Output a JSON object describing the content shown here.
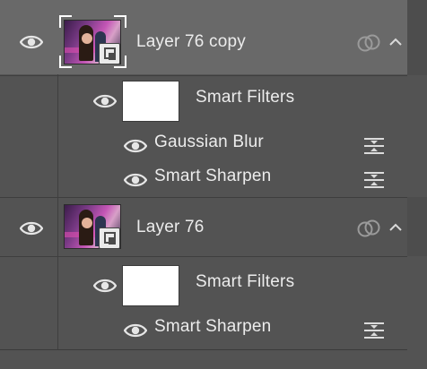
{
  "layers": [
    {
      "name": "Layer 76 copy",
      "selected": true,
      "smart_filters_label": "Smart Filters",
      "filters": [
        "Gaussian Blur",
        "Smart Sharpen"
      ]
    },
    {
      "name": "Layer 76",
      "selected": false,
      "smart_filters_label": "Smart Filters",
      "filters": [
        "Smart Sharpen"
      ]
    }
  ],
  "icons": {
    "visibility": "eye-icon",
    "smart_object": "smart-object-badge-icon",
    "filter_effects": "filter-effects-icon",
    "link": "linked-rings-icon",
    "collapse": "chevron-up-icon"
  },
  "colors": {
    "panel_bg": "#535353",
    "selected_row_bg": "#696969",
    "text": "#ececec"
  }
}
